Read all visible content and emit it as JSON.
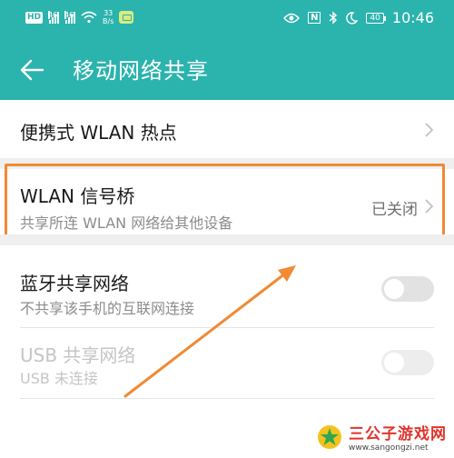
{
  "status_bar": {
    "hd": "HD",
    "sig1": "46",
    "sig2": "46",
    "speed_value": "33",
    "speed_unit": "B/s",
    "nfc": "N",
    "battery": "40",
    "time": "10:46"
  },
  "header": {
    "title": "移动网络共享"
  },
  "items": [
    {
      "title": "便携式 WLAN 热点"
    },
    {
      "title": "WLAN 信号桥",
      "subtitle": "共享所连 WLAN 网络给其他设备",
      "value": "已关闭"
    },
    {
      "title": "蓝牙共享网络",
      "subtitle": "不共享该手机的互联网连接",
      "toggle_on": false
    },
    {
      "title": "USB 共享网络",
      "subtitle": "USB 未连接",
      "toggle_on": false,
      "disabled": true
    }
  ],
  "watermark": {
    "name": "三公子游戏网",
    "url": "www.sangongzi.net"
  },
  "colors": {
    "header_bg": "#2bb3ad",
    "highlight_border": "#f08a33",
    "annotation_arrow": "#f08a33"
  }
}
